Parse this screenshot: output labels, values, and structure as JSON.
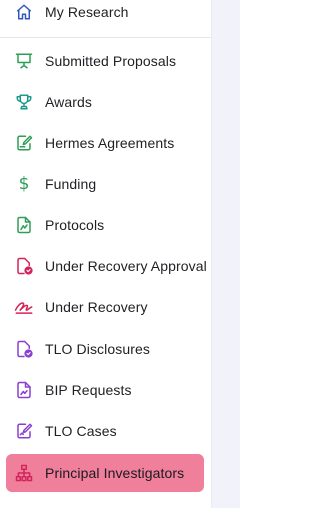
{
  "sidebar": {
    "items": [
      {
        "label": "My Research",
        "icon": "home-icon",
        "color": "#2f57b8"
      },
      {
        "label": "Submitted Proposals",
        "icon": "presentation-icon",
        "color": "#2e9d57"
      },
      {
        "label": "Awards",
        "icon": "trophy-icon",
        "color": "#1c9a8a"
      },
      {
        "label": "Hermes Agreements",
        "icon": "document-edit-icon",
        "color": "#2e9d57"
      },
      {
        "label": "Funding",
        "icon": "dollar-icon",
        "color": "#2e9d57"
      },
      {
        "label": "Protocols",
        "icon": "protocol-document-icon",
        "color": "#2e9d57"
      },
      {
        "label": "Under Recovery Approval",
        "icon": "document-check-icon",
        "color": "#d2245a"
      },
      {
        "label": "Under Recovery",
        "icon": "signature-icon",
        "color": "#d2245a"
      },
      {
        "label": "TLO Disclosures",
        "icon": "document-badge-icon",
        "color": "#8a3fd1"
      },
      {
        "label": "BIP Requests",
        "icon": "image-document-icon",
        "color": "#8a3fd1"
      },
      {
        "label": "TLO Cases",
        "icon": "edit-case-icon",
        "color": "#8a3fd1"
      },
      {
        "label": "Principal Investigators",
        "icon": "org-chart-icon",
        "color": "#d2245a"
      }
    ],
    "active_label": "Principal Investigators",
    "active_color": "#ef7f9b"
  }
}
